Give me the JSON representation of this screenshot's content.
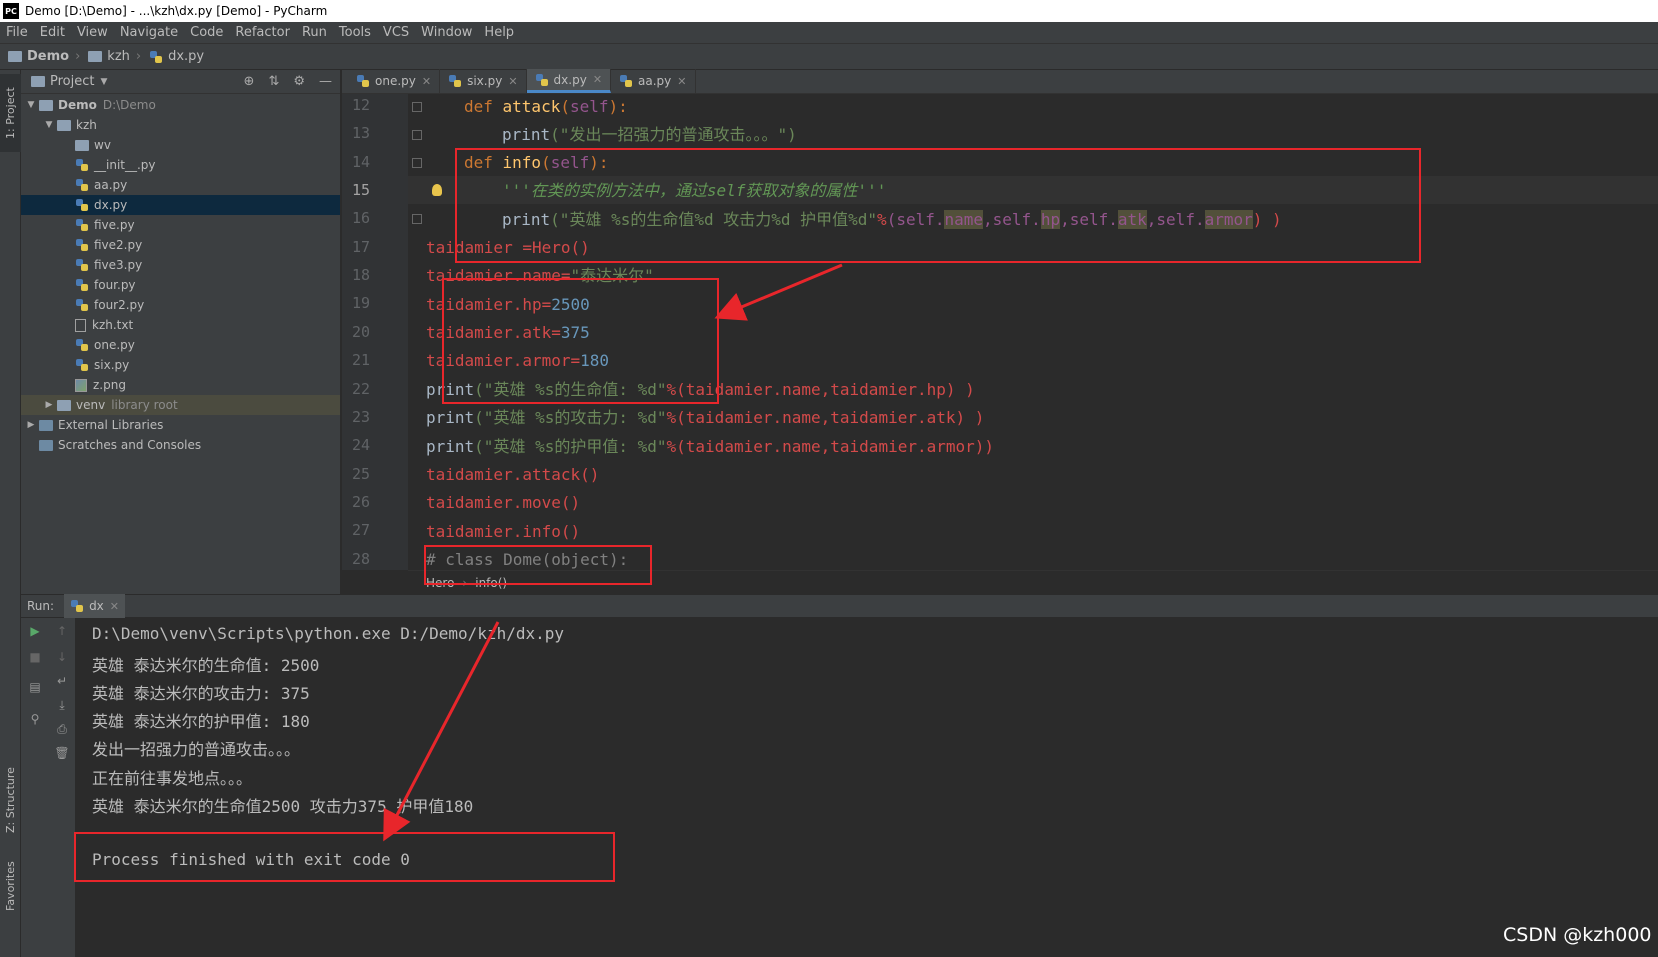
{
  "window": {
    "title": "Demo [D:\\Demo] - ...\\kzh\\dx.py [Demo] - PyCharm",
    "logo": "PC"
  },
  "menu": [
    "File",
    "Edit",
    "View",
    "Navigate",
    "Code",
    "Refactor",
    "Run",
    "Tools",
    "VCS",
    "Window",
    "Help"
  ],
  "breadcrumb": [
    "Demo",
    "kzh",
    "dx.py"
  ],
  "left_strip": {
    "project": "1: Project",
    "structure": "Z: Structure",
    "favorites": "Favorites"
  },
  "project_panel": {
    "title": "Project",
    "tree": [
      {
        "label": "Demo",
        "extra": "D:\\Demo",
        "depth": 0,
        "type": "folder",
        "expanded": true
      },
      {
        "label": "kzh",
        "depth": 1,
        "type": "folder",
        "expanded": true
      },
      {
        "label": "wv",
        "depth": 2,
        "type": "folder"
      },
      {
        "label": "__init__.py",
        "depth": 2,
        "type": "py"
      },
      {
        "label": "aa.py",
        "depth": 2,
        "type": "py"
      },
      {
        "label": "dx.py",
        "depth": 2,
        "type": "py",
        "selected": true
      },
      {
        "label": "five.py",
        "depth": 2,
        "type": "py"
      },
      {
        "label": "five2.py",
        "depth": 2,
        "type": "py"
      },
      {
        "label": "five3.py",
        "depth": 2,
        "type": "py"
      },
      {
        "label": "four.py",
        "depth": 2,
        "type": "py"
      },
      {
        "label": "four2.py",
        "depth": 2,
        "type": "py"
      },
      {
        "label": "kzh.txt",
        "depth": 2,
        "type": "txt"
      },
      {
        "label": "one.py",
        "depth": 2,
        "type": "py"
      },
      {
        "label": "six.py",
        "depth": 2,
        "type": "py"
      },
      {
        "label": "z.png",
        "depth": 2,
        "type": "png"
      },
      {
        "label": "venv",
        "extra": "library root",
        "depth": 1,
        "type": "folder",
        "collapsed": true,
        "lib": true
      },
      {
        "label": "External Libraries",
        "depth": 0,
        "type": "lib",
        "collapsed": true
      },
      {
        "label": "Scratches and Consoles",
        "depth": 0,
        "type": "scratch"
      }
    ]
  },
  "editor": {
    "tabs": [
      {
        "label": "one.py",
        "active": false
      },
      {
        "label": "six.py",
        "active": false
      },
      {
        "label": "dx.py",
        "active": true
      },
      {
        "label": "aa.py",
        "active": false
      }
    ],
    "line_numbers": [
      "12",
      "13",
      "14",
      "15",
      "16",
      "17",
      "18",
      "19",
      "20",
      "21",
      "22",
      "23",
      "24",
      "25",
      "26",
      "27",
      "28"
    ],
    "current_line": "15",
    "code": {
      "l12": {
        "kw": "def ",
        "fn": "attack",
        "p1": "(",
        "self": "self",
        "p2": "):"
      },
      "l13": {
        "pr": "print",
        "str": "(\"发出一招强力的普通攻击。。。\")"
      },
      "l14": {
        "kw": "def ",
        "fn": "info",
        "p1": "(",
        "self": "self",
        "p2": "):"
      },
      "l15": {
        "doc": "'''在类的实例方法中，通过self获取对象的属性'''"
      },
      "l16": {
        "pr": "print",
        "str": "(\"英雄 %s的生命值%d 攻击力%d 护甲值%d\"",
        "pct": "%",
        "a": "(self.",
        "n1": "name",
        "c1": ",self.",
        "n2": "hp",
        "c2": ",self.",
        "n3": "atk",
        "c3": ",self.",
        "n4": "armor",
        "end": ") )"
      },
      "l17": {
        "t": "taidamier =Hero()"
      },
      "l18": {
        "t": "taidamier.name=",
        "s": "\"泰达米尔\""
      },
      "l19": {
        "t": "taidamier.hp=",
        "n": "2500"
      },
      "l20": {
        "t": "taidamier.atk=",
        "n": "375"
      },
      "l21": {
        "t": "taidamier.armor=",
        "n": "180"
      },
      "l22": {
        "pr": "print",
        "s": "(\"英雄 %s的生命值: %d\"",
        "t": "%(taidamier.name,taidamier.hp) )"
      },
      "l23": {
        "pr": "print",
        "s": "(\"英雄 %s的攻击力: %d\"",
        "t": "%(taidamier.name,taidamier.atk) )"
      },
      "l24": {
        "pr": "print",
        "s": "(\"英雄 %s的护甲值: %d\"",
        "t": "%(taidamier.name,taidamier.armor))"
      },
      "l25": {
        "t": "taidamier.attack()"
      },
      "l26": {
        "t": "taidamier.move()"
      },
      "l27": {
        "t": "taidamier.info()"
      },
      "l28": {
        "cm": "# class Dome(object):"
      }
    },
    "breadcrumb": [
      "Hero",
      "info()"
    ]
  },
  "run": {
    "label": "Run:",
    "tab": "dx",
    "output": [
      "D:\\Demo\\venv\\Scripts\\python.exe D:/Demo/kzh/dx.py",
      "英雄 泰达米尔的生命值: 2500",
      "英雄 泰达米尔的攻击力: 375",
      "英雄 泰达米尔的护甲值: 180",
      "发出一招强力的普通攻击。。。",
      "正在前往事发地点。。。",
      "英雄 泰达米尔的生命值2500 攻击力375 护甲值180",
      "",
      "Process finished with exit code 0"
    ]
  },
  "watermark": "CSDN @kzh000",
  "colors": {
    "annotation": "#e8262b",
    "selection": "#0d293e",
    "keyword": "#cc7832",
    "function": "#ffc66d",
    "string": "#6a8759"
  }
}
